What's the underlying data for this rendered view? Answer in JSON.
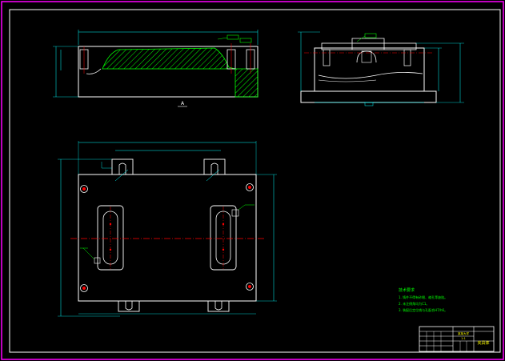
{
  "drawing": {
    "section_label": "A",
    "notes_heading": "技术要求",
    "notes": [
      "1. 铸件不得有砂眼、缩孔等缺陷。",
      "2. 未注倒角均为C1。",
      "3. 装配后定位销与孔配合H7/h6。"
    ],
    "title_block": {
      "drawing_name": "夹具体",
      "company": "某某大学",
      "scale": "1:1"
    },
    "colors": {
      "background": "#000000",
      "border": "#ff00ff",
      "outline": "#ffffff",
      "hatch": "#00ff00",
      "centerline": "#ff0000",
      "dimension": "#00ffff",
      "title_text": "#ffff00"
    }
  }
}
